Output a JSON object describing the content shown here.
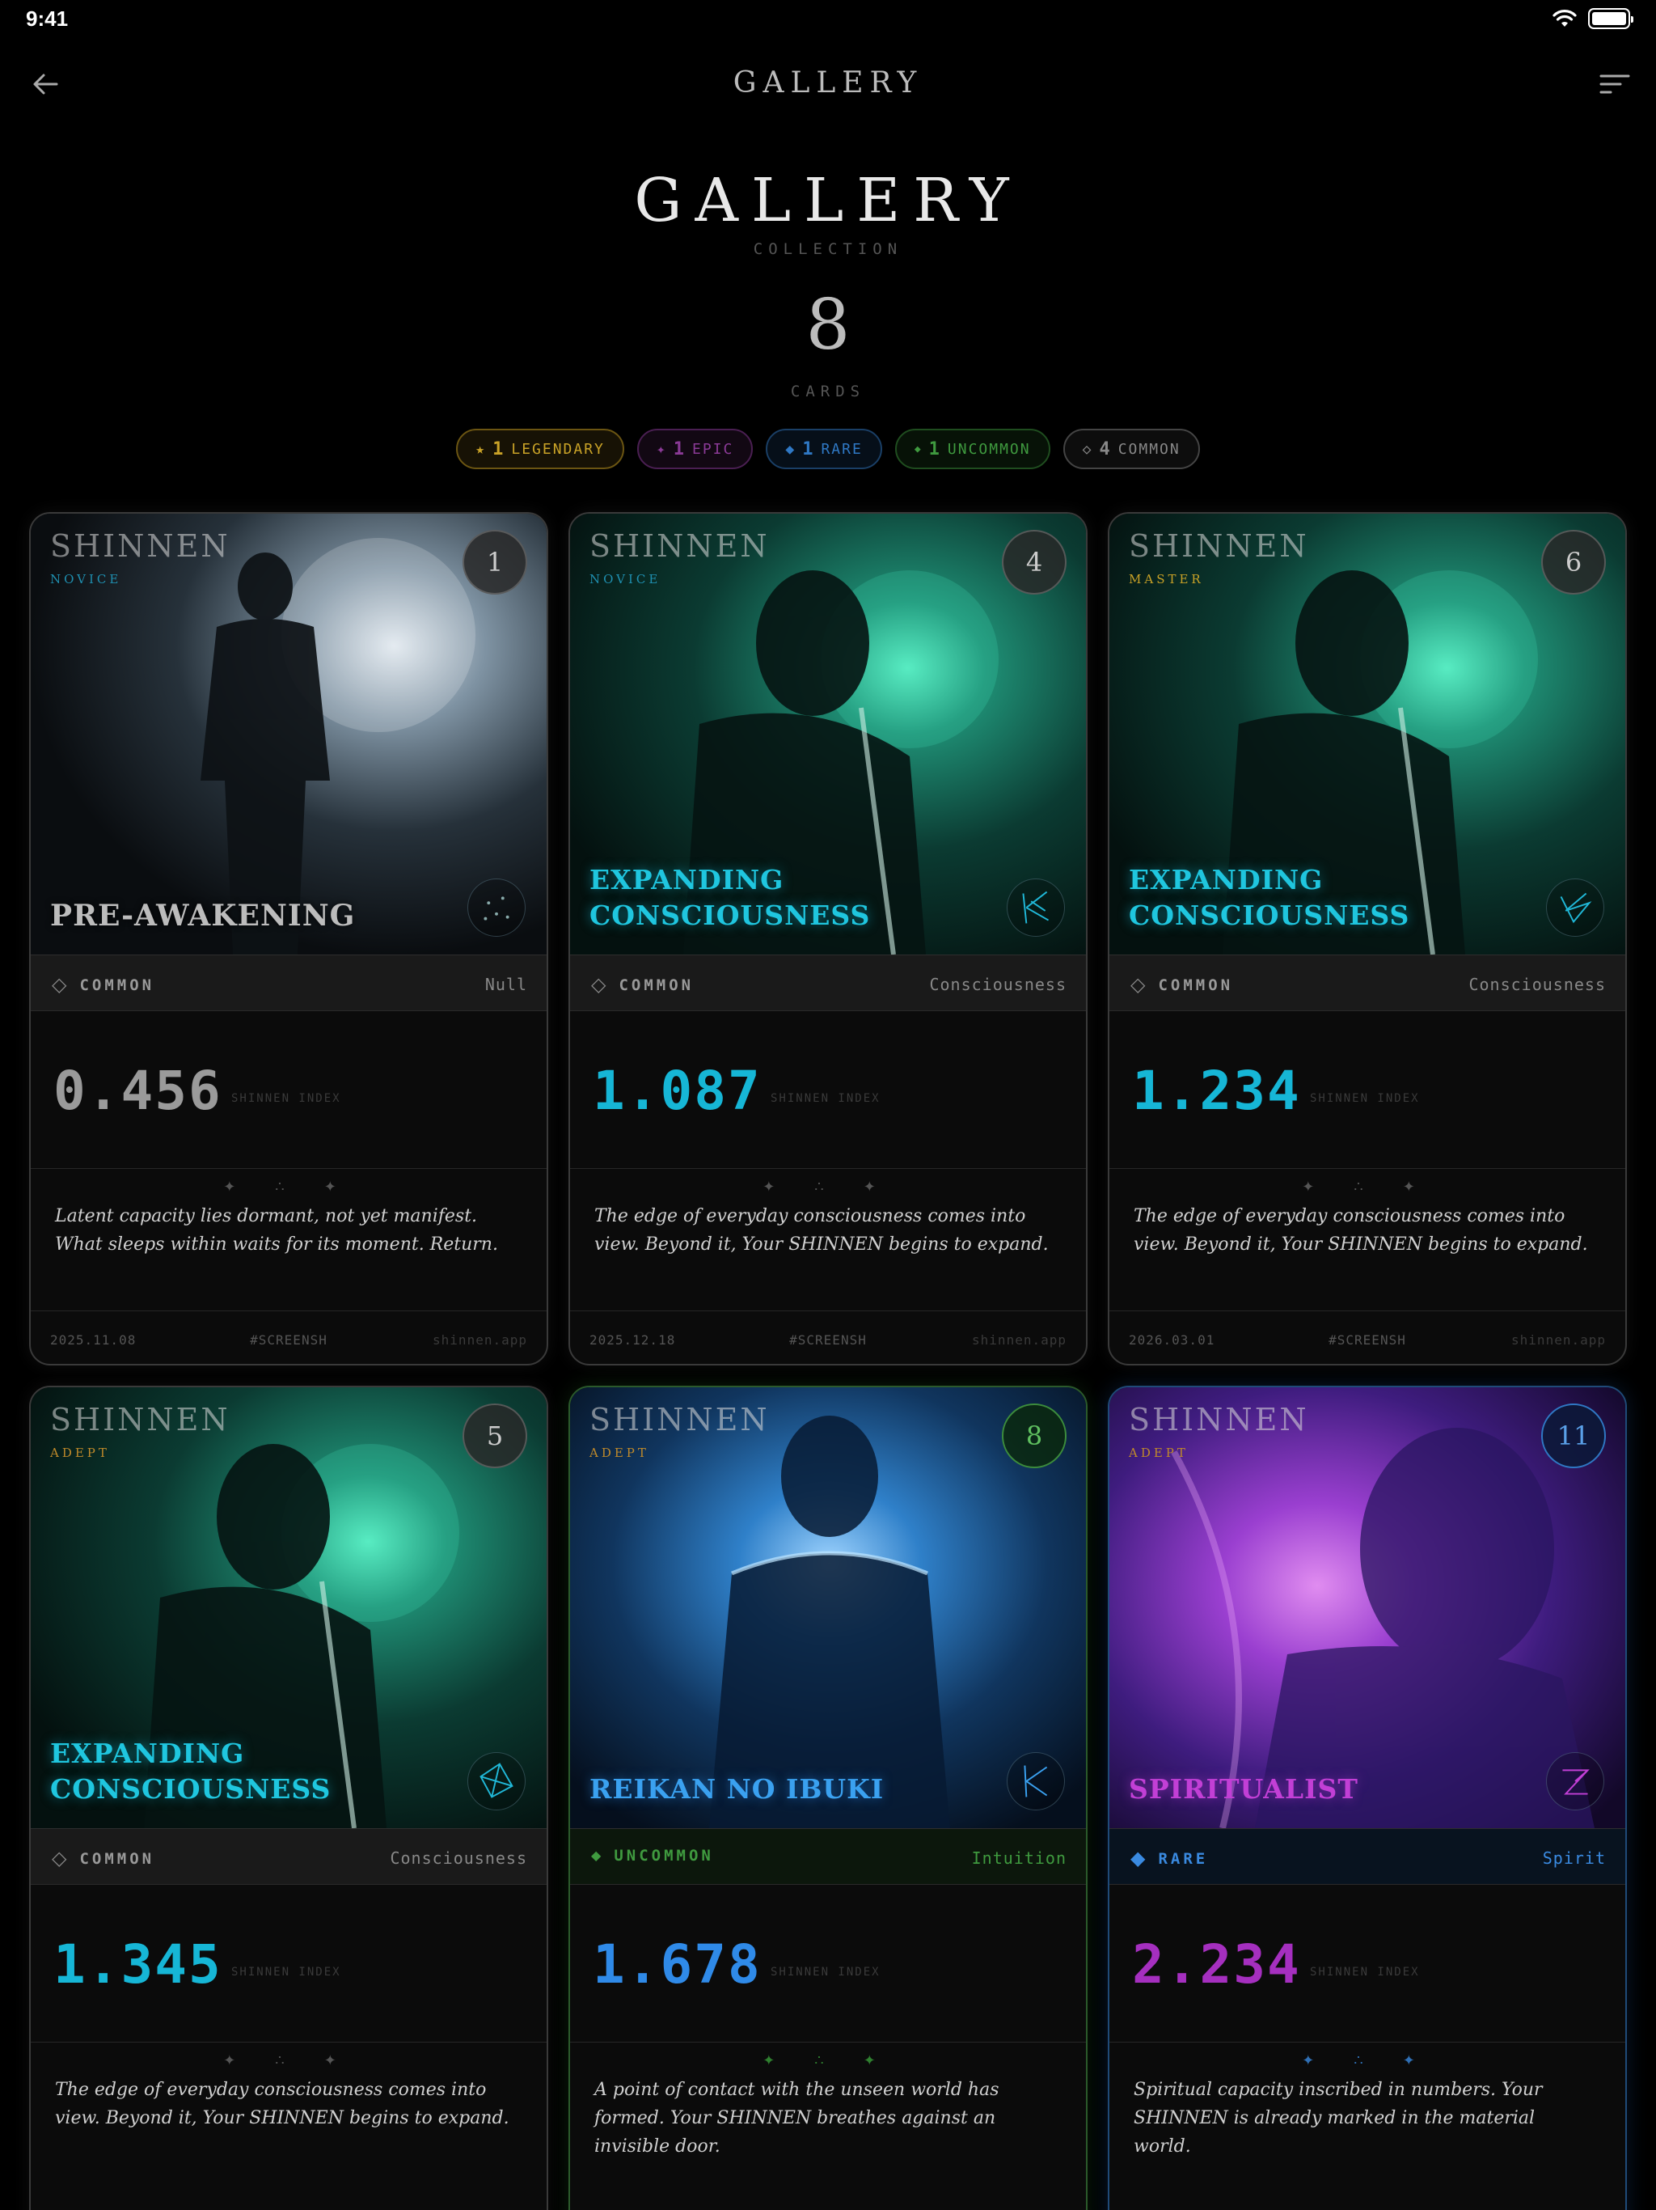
{
  "status_bar": {
    "time": "9:41"
  },
  "nav": {
    "title": "GALLERY"
  },
  "hero": {
    "title": "GALLERY",
    "subtitle": "COLLECTION",
    "count": "8",
    "count_label": "CARDS"
  },
  "summary": [
    {
      "icon": "star-icon",
      "count": "1",
      "label": "LEGENDARY",
      "color": "#c9a227"
    },
    {
      "icon": "sparkle-icon",
      "count": "1",
      "label": "EPIC",
      "color": "#8a3a96"
    },
    {
      "icon": "diamond-filled-icon",
      "count": "1",
      "label": "RARE",
      "color": "#2f78c4"
    },
    {
      "icon": "small-diamond-icon",
      "count": "1",
      "label": "UNCOMMON",
      "color": "#3f9a3f"
    },
    {
      "icon": "diamond-outline-icon",
      "count": "4",
      "label": "COMMON",
      "color": "#888888"
    }
  ],
  "cards": [
    {
      "brand": "SHINNEN",
      "tier": "NOVICE",
      "number": "1",
      "name": "PRE-AWAKENING",
      "rarity": "COMMON",
      "attribute": "Null",
      "index": "0.456",
      "index_label": "SHINNEN INDEX",
      "description": "Latent capacity lies dormant, not yet manifest. What sleeps within waits for its moment. Return.",
      "date": "2025.11.08",
      "tag": "#SCREENSH",
      "site": "shinnen.app"
    },
    {
      "brand": "SHINNEN",
      "tier": "NOVICE",
      "number": "4",
      "name": "EXPANDING CONSCIOUSNESS",
      "rarity": "COMMON",
      "attribute": "Consciousness",
      "index": "1.087",
      "index_label": "SHINNEN INDEX",
      "description": "The edge of everyday consciousness comes into view. Beyond it, Your SHINNEN begins to expand.",
      "date": "2025.12.18",
      "tag": "#SCREENSH",
      "site": "shinnen.app"
    },
    {
      "brand": "SHINNEN",
      "tier": "MASTER",
      "number": "6",
      "name": "EXPANDING CONSCIOUSNESS",
      "rarity": "COMMON",
      "attribute": "Consciousness",
      "index": "1.234",
      "index_label": "SHINNEN INDEX",
      "description": "The edge of everyday consciousness comes into view. Beyond it, Your SHINNEN begins to expand.",
      "date": "2026.03.01",
      "tag": "#SCREENSH",
      "site": "shinnen.app"
    },
    {
      "brand": "SHINNEN",
      "tier": "ADEPT",
      "number": "5",
      "name": "EXPANDING CONSCIOUSNESS",
      "rarity": "COMMON",
      "attribute": "Consciousness",
      "index": "1.345",
      "index_label": "SHINNEN INDEX",
      "description": "The edge of everyday consciousness comes into view. Beyond it, Your SHINNEN begins to expand."
    },
    {
      "brand": "SHINNEN",
      "tier": "ADEPT",
      "number": "8",
      "name": "REIKAN NO IBUKI",
      "rarity": "UNCOMMON",
      "attribute": "Intuition",
      "index": "1.678",
      "index_label": "SHINNEN INDEX",
      "description": "A point of contact with the unseen world has formed. Your SHINNEN breathes against an invisible door."
    },
    {
      "brand": "SHINNEN",
      "tier": "ADEPT",
      "number": "11",
      "name": "SPIRITUALIST",
      "rarity": "RARE",
      "attribute": "Spirit",
      "index": "2.234",
      "index_label": "SHINNEN INDEX",
      "description": "Spiritual capacity inscribed in numbers. Your SHINNEN is already marked in the material world."
    }
  ],
  "ornament": "✦ ∴ ✦"
}
